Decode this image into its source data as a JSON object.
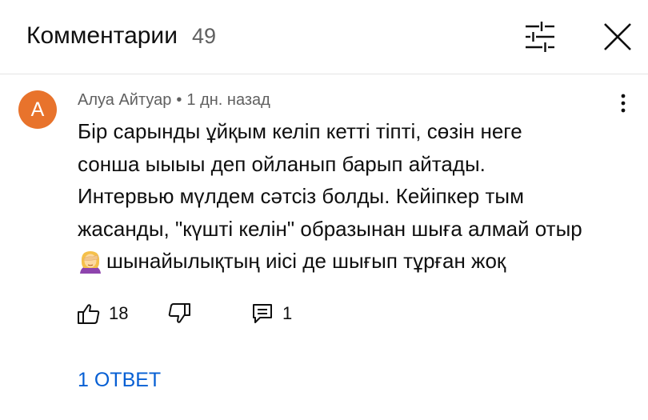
{
  "header": {
    "title": "Комментарии",
    "count": "49"
  },
  "comment": {
    "avatar_letter": "А",
    "author": "Алуа Айтуар",
    "separator": "•",
    "time": "1 дн. назад",
    "lines": [
      "Бір сарынды ұйқым келіп кетті тіпті, сөзін неге",
      "сонша ыыыы деп ойланып барып айтады.",
      "Интервью мүлдем сәтсіз болды. Кейіпкер тым",
      "жасанды, \"күшті келін\" образынан шыға алмай отыр",
      "шынайылықтың иісі де шығып тұрған жоқ"
    ],
    "likes": "18",
    "replies_count": "1",
    "reply_link": "1 ОТВЕТ"
  },
  "colors": {
    "avatar": "#e8732c",
    "link": "#065fd4",
    "secondary_text": "#606060"
  },
  "icons": [
    "filter-icon",
    "close-icon",
    "more-vert-icon",
    "like-icon",
    "dislike-icon",
    "reply-icon",
    "facepalm-emoji-icon"
  ]
}
